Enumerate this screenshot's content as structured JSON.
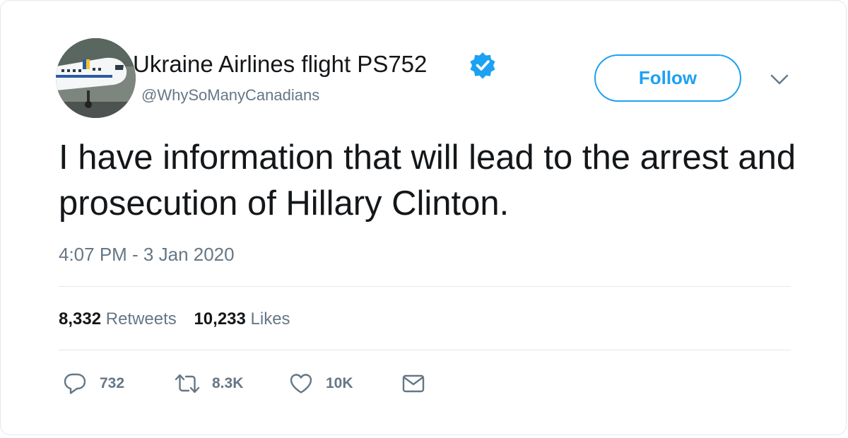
{
  "account": {
    "display_name": "Ukraine Airlines flight PS752",
    "handle": "@WhySoManyCanadians",
    "verified": true
  },
  "follow_label": "Follow",
  "tweet": {
    "text": "I have information that will lead to the arrest and prosecution of Hillary Clinton.",
    "timestamp": "4:07 PM - 3 Jan 2020"
  },
  "stats": {
    "retweets_count": "8,332",
    "retweets_label": "Retweets",
    "likes_count": "10,233",
    "likes_label": "Likes"
  },
  "actions": {
    "replies": "732",
    "retweets": "8.3K",
    "likes": "10K"
  },
  "colors": {
    "accent": "#1da1f2",
    "text": "#14171a",
    "muted": "#657786",
    "border": "#e1e8ed"
  },
  "icons": {
    "verified": "verified-badge-icon",
    "chevron": "chevron-down-icon",
    "reply": "reply-icon",
    "retweet": "retweet-icon",
    "like": "heart-icon",
    "dm": "envelope-icon"
  }
}
